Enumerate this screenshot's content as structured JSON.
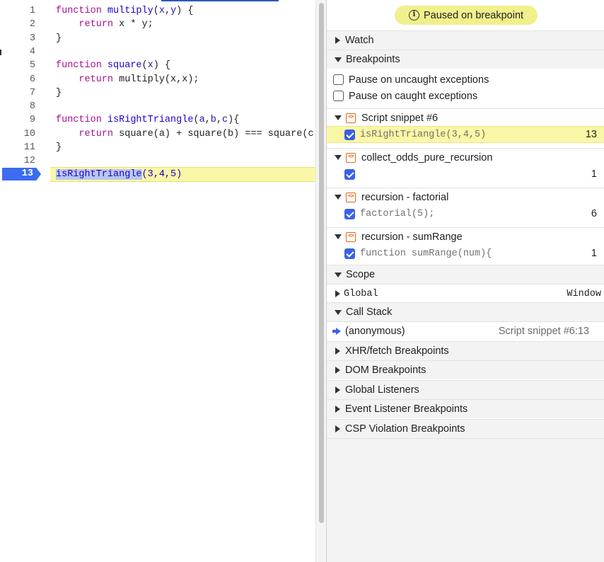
{
  "editor": {
    "lines": [
      {
        "n": "1",
        "parts": [
          [
            "kw",
            "function "
          ],
          [
            "fn",
            "multiply"
          ],
          [
            "op",
            "("
          ],
          [
            "prm",
            "x"
          ],
          [
            "op",
            ","
          ],
          [
            "prm",
            "y"
          ],
          [
            "op",
            ") {"
          ]
        ]
      },
      {
        "n": "2",
        "parts": [
          [
            "op",
            "    "
          ],
          [
            "kw",
            "return"
          ],
          [
            "op",
            " x * y;"
          ]
        ]
      },
      {
        "n": "3",
        "parts": [
          [
            "op",
            "}"
          ]
        ]
      },
      {
        "n": "4",
        "parts": []
      },
      {
        "n": "5",
        "parts": [
          [
            "kw",
            "function "
          ],
          [
            "fn",
            "square"
          ],
          [
            "op",
            "("
          ],
          [
            "prm",
            "x"
          ],
          [
            "op",
            ") {"
          ]
        ]
      },
      {
        "n": "6",
        "parts": [
          [
            "op",
            "    "
          ],
          [
            "kw",
            "return"
          ],
          [
            "op",
            " multiply(x,x);"
          ]
        ]
      },
      {
        "n": "7",
        "parts": [
          [
            "op",
            "}"
          ]
        ]
      },
      {
        "n": "8",
        "parts": []
      },
      {
        "n": "9",
        "parts": [
          [
            "kw",
            "function "
          ],
          [
            "fn",
            "isRightTriangle"
          ],
          [
            "op",
            "("
          ],
          [
            "prm",
            "a"
          ],
          [
            "op",
            ","
          ],
          [
            "prm",
            "b"
          ],
          [
            "op",
            ","
          ],
          [
            "prm",
            "c"
          ],
          [
            "op",
            "){"
          ]
        ]
      },
      {
        "n": "10",
        "parts": [
          [
            "op",
            "    "
          ],
          [
            "kw",
            "return"
          ],
          [
            "op",
            " square(a) + square(b) === square(c"
          ]
        ]
      },
      {
        "n": "11",
        "parts": [
          [
            "op",
            "}"
          ]
        ]
      },
      {
        "n": "12",
        "parts": []
      }
    ],
    "exec_line_number": "13",
    "exec_selected": "isRightTriangle",
    "exec_rest": "(3,4,5)"
  },
  "sidebar": {
    "paused_label": "Paused on breakpoint",
    "watch_label": "Watch",
    "breakpoints_label": "Breakpoints",
    "pause_uncaught": "Pause on uncaught exceptions",
    "pause_caught": "Pause on caught exceptions",
    "breakpoint_files": [
      {
        "file": "Script snippet #6",
        "code": "isRightTriangle(3,4,5)",
        "line": "13",
        "highlight": true
      },
      {
        "file": "collect_odds_pure_recursion",
        "code": "",
        "line": "1",
        "highlight": false
      },
      {
        "file": "recursion - factorial",
        "code": "factorial(5);",
        "line": "6",
        "highlight": false
      },
      {
        "file": "recursion - sumRange",
        "code": "function sumRange(num){",
        "line": "1",
        "highlight": false
      }
    ],
    "scope_label": "Scope",
    "scope_global_label": "Global",
    "scope_global_value": "Window",
    "callstack_label": "Call Stack",
    "callstack_frame": "(anonymous)",
    "callstack_location": "Script snippet #6:13",
    "collapsed_sections": [
      "XHR/fetch Breakpoints",
      "DOM Breakpoints",
      "Global Listeners",
      "Event Listener Breakpoints",
      "CSP Violation Breakpoints"
    ]
  },
  "colors": {
    "accent": "#3b60e6",
    "paused_bg": "#f1f08c",
    "exec_line_bg": "#faf7a6",
    "file_icon": "#e0661d"
  }
}
